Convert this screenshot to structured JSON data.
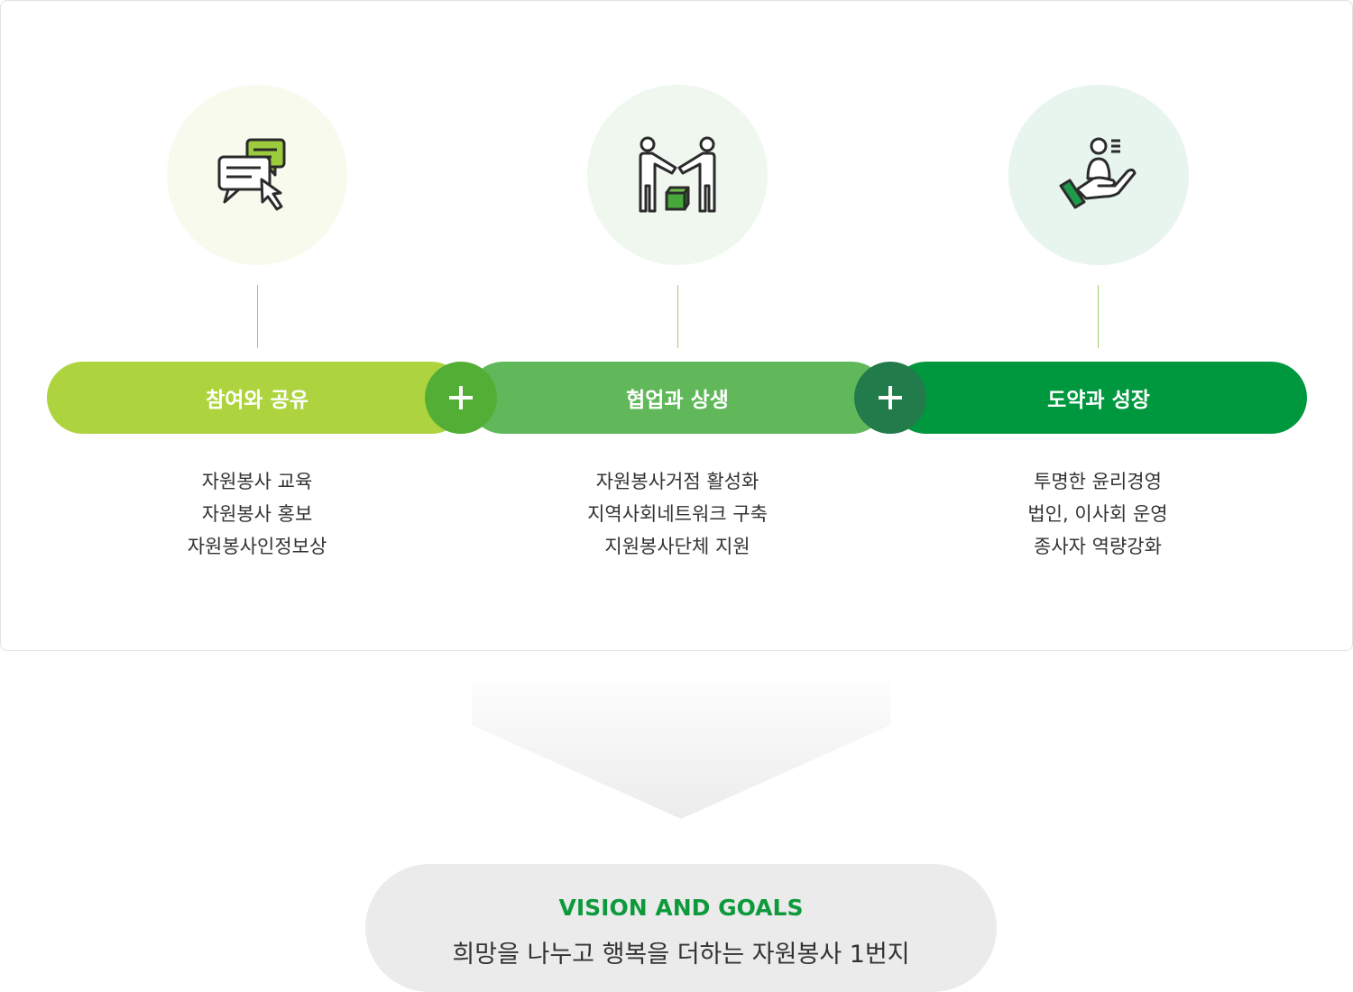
{
  "pillars": [
    {
      "title": "참여와 공유",
      "icon": "chat-bubbles-cursor-icon",
      "items": [
        "자원봉사 교육",
        "자원봉사 홍보",
        "자원봉사인정보상"
      ]
    },
    {
      "title": "협업과 상생",
      "icon": "people-handshake-box-icon",
      "items": [
        "자원봉사거점 활성화",
        "지역사회네트워크 구축",
        "지원봉사단체 지원"
      ]
    },
    {
      "title": "도약과 성장",
      "icon": "hand-holding-person-icon",
      "items": [
        "투명한 윤리경영",
        "법인, 이사회 운영",
        "종사자 역량강화"
      ]
    }
  ],
  "connectors": [
    "plus-icon",
    "plus-icon"
  ],
  "vision": {
    "title": "VISION AND GOALS",
    "text": "희망을 나누고 행복을 더하는 자원봉사 1번지"
  },
  "colors": {
    "pillar1": "#add43f",
    "pillar2": "#60b85b",
    "pillar3": "#00983f",
    "plus1": "#52ae35",
    "plus2": "#227b4a",
    "circle1": "#f8faee",
    "circle2": "#eff7ef",
    "circle3": "#e8f5ee",
    "accent": "#0e9a3c"
  }
}
